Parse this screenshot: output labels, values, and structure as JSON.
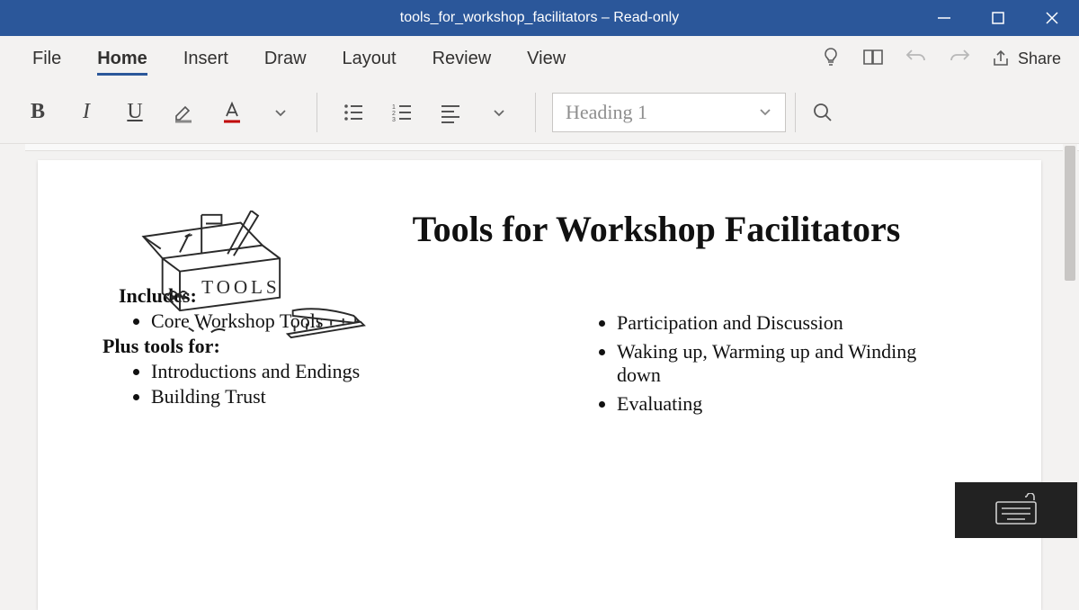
{
  "window": {
    "title": "tools_for_workshop_facilitators – Read-only"
  },
  "tabs": {
    "file": "File",
    "home": "Home",
    "insert": "Insert",
    "draw": "Draw",
    "layout": "Layout",
    "review": "Review",
    "view": "View"
  },
  "share_label": "Share",
  "ribbon": {
    "bold": "B",
    "italic": "I",
    "underline": "U",
    "style_name": "Heading 1"
  },
  "document": {
    "title": "Tools for Workshop Facilitators",
    "includes_label": "Includes:",
    "plus_label": "Plus tools for:",
    "col1": {
      "includes_items": [
        "Core Workshop Tools"
      ],
      "plus_items": [
        "Introductions and Endings",
        "Building Trust"
      ]
    },
    "col2": {
      "items": [
        "Participation and Discussion",
        "Waking up, Warming up and Winding down",
        "Evaluating"
      ]
    },
    "toolbox_caption": "TOOLS"
  }
}
